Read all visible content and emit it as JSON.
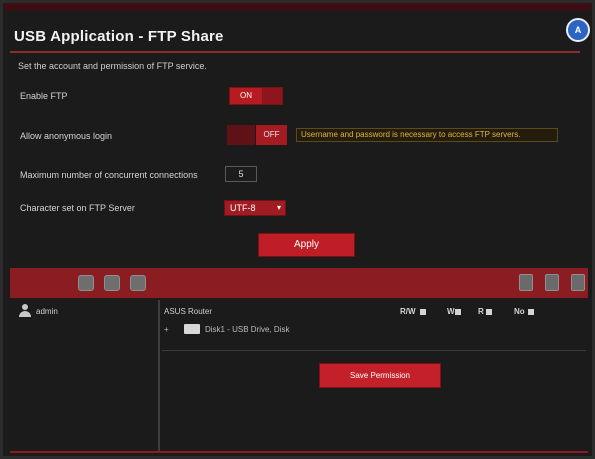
{
  "page": {
    "title": "USB Application - FTP Share",
    "description": "Set the account and permission of FTP service."
  },
  "settings": {
    "enable_ftp": {
      "label": "Enable FTP",
      "value": "ON"
    },
    "allow_anonymous": {
      "label": "Allow anonymous login",
      "value": "OFF",
      "warning": "Username and password is necessary to access FTP servers."
    },
    "max_connections": {
      "label": "Maximum number of concurrent connections",
      "value": "5"
    },
    "character_set": {
      "label": "Character set on FTP Server",
      "value": "UTF-8"
    }
  },
  "apply_label": "Apply",
  "account_panel": {
    "user": "admin",
    "files_header": "ASUS Router",
    "columns": [
      "R/W",
      "W",
      "R",
      "No"
    ],
    "tree_item": "Disk1 - USB Drive, Disk"
  },
  "save_label": "Save Permission",
  "colors": {
    "accent": "#8a1c22",
    "button": "#c4202a",
    "warning": "#e2b43a"
  }
}
